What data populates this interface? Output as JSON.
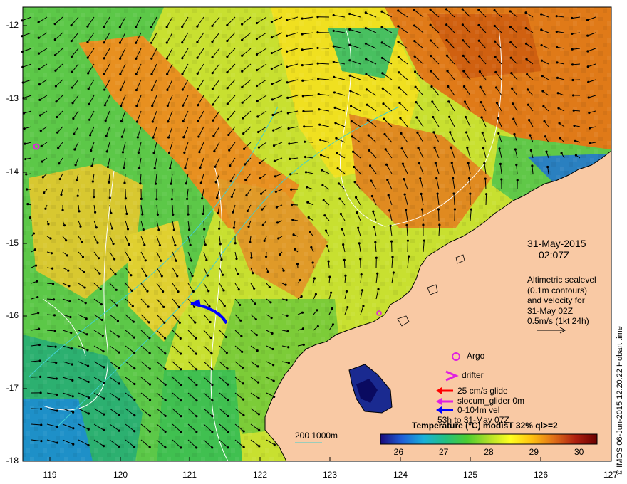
{
  "map": {
    "lat_ticks": [
      "-12",
      "-13",
      "-14",
      "-15",
      "-16",
      "-17",
      "-18"
    ],
    "lon_ticks": [
      "119",
      "120",
      "121",
      "122",
      "123",
      "124",
      "125",
      "126",
      "127"
    ],
    "colors": {
      "land": "#f9c9a4",
      "coast": "#000000",
      "contour": "#ffffff",
      "isobath": "#40d0d0"
    }
  },
  "info": {
    "date": "31-May-2015",
    "time": "02:07Z",
    "altimetry": [
      "Altimetric sealevel",
      "(0.1m contours)",
      "and velocity for",
      "31-May 02Z",
      "0.5m/s (1kt 24h)"
    ]
  },
  "legend": {
    "argo": "Argo",
    "drifter": "drifter",
    "glide": "25 cm/s glide",
    "slocum": "slocum_glider 0m",
    "vel": "0-104m vel",
    "track": "53h to 31-May 07Z",
    "depth": "200  1000m",
    "argo_color": "#e020e0",
    "glide_color": "#ff0000",
    "slocum_color": "#e020e0",
    "vel_color": "#0000ff"
  },
  "colorbar": {
    "title": "Temperature (°C) modisT 32% ql>=2",
    "ticks": [
      "26",
      "27",
      "28",
      "29",
      "30"
    ],
    "range": [
      25.6,
      30.4
    ],
    "stops": [
      "#1a0a7a",
      "#1e5fd8",
      "#19b0d8",
      "#22c080",
      "#4ccc30",
      "#b0e028",
      "#ffff20",
      "#ffc010",
      "#e07018",
      "#b02010",
      "#6a0000"
    ]
  },
  "credit": "© IMOS 06-Jun-2015 12:20:22 Hobart time"
}
